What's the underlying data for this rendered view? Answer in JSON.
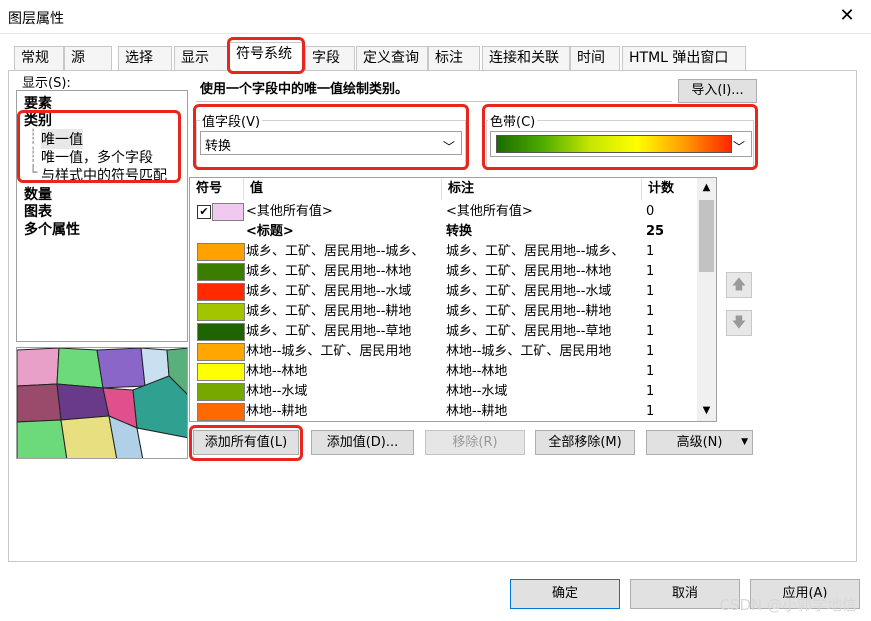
{
  "window": {
    "title": "图层属性",
    "close_glyph": "✕"
  },
  "tabs": [
    "常规",
    "源",
    "选择",
    "显示",
    "符号系统",
    "字段",
    "定义查询",
    "标注",
    "连接和关联",
    "时间",
    "HTML 弹出窗口"
  ],
  "show_label": "显示(S):",
  "tree": {
    "items": [
      {
        "label": "要素",
        "bold": true
      },
      {
        "label": "类别",
        "bold": true
      },
      {
        "label": "唯一值",
        "bold": false,
        "indent": true,
        "selected": true
      },
      {
        "label": "唯一值，多个字段",
        "bold": false,
        "indent": true
      },
      {
        "label": "与样式中的符号匹配",
        "bold": false,
        "indent": true
      },
      {
        "label": "数量",
        "bold": true
      },
      {
        "label": "图表",
        "bold": true
      },
      {
        "label": "多个属性",
        "bold": true
      }
    ]
  },
  "description": "使用一个字段中的唯一值绘制类别。",
  "import_button": "导入(I)...",
  "value_field": {
    "label": "值字段(V)",
    "value": "转换"
  },
  "color_ramp": {
    "label": "色带(C)",
    "stops": [
      "#1a6b00",
      "#4fae00",
      "#c6e600",
      "#ffff00",
      "#ff9b00",
      "#ff2600"
    ]
  },
  "table": {
    "headers": [
      "符号",
      "值",
      "标注",
      "计数"
    ],
    "rows": [
      {
        "checkbox": true,
        "color": "#f0c8f0",
        "value": "<其他所有值>",
        "label": "<其他所有值>",
        "count": "0"
      },
      {
        "heading": true,
        "value": "<标题>",
        "label": "转换",
        "count": "25"
      },
      {
        "color": "#ffa200",
        "value": "城乡、工矿、居民用地--城乡、",
        "label": "城乡、工矿、居民用地--城乡、",
        "count": "1"
      },
      {
        "color": "#3b7d00",
        "value": "城乡、工矿、居民用地--林地",
        "label": "城乡、工矿、居民用地--林地",
        "count": "1"
      },
      {
        "color": "#ff2a00",
        "value": "城乡、工矿、居民用地--水域",
        "label": "城乡、工矿、居民用地--水域",
        "count": "1"
      },
      {
        "color": "#a3c500",
        "value": "城乡、工矿、居民用地--耕地",
        "label": "城乡、工矿、居民用地--耕地",
        "count": "1"
      },
      {
        "color": "#1e6400",
        "value": "城乡、工矿、居民用地--草地",
        "label": "城乡、工矿、居民用地--草地",
        "count": "1"
      },
      {
        "color": "#ffa600",
        "value": "林地--城乡、工矿、居民用地",
        "label": "林地--城乡、工矿、居民用地",
        "count": "1"
      },
      {
        "color": "#ffff00",
        "value": "林地--林地",
        "label": "林地--林地",
        "count": "1"
      },
      {
        "color": "#76a800",
        "value": "林地--水域",
        "label": "林地--水域",
        "count": "1"
      },
      {
        "color": "#ff6a00",
        "value": "林地--耕地",
        "label": "林地--耕地",
        "count": "1"
      }
    ]
  },
  "buttons": {
    "add_all": "添加所有值(L)",
    "add": "添加值(D)...",
    "remove": "移除(R)",
    "remove_all": "全部移除(M)",
    "advanced": "高级(N)"
  },
  "footer": {
    "ok": "确定",
    "cancel": "取消",
    "apply": "应用(A)"
  },
  "watermark": "CSDN @小郭学地信",
  "icons": {
    "up": "▲",
    "down": "▼",
    "chevron": "﹀",
    "move_up": "🡅",
    "move_down": "🡇"
  },
  "accent": "#e8261e"
}
